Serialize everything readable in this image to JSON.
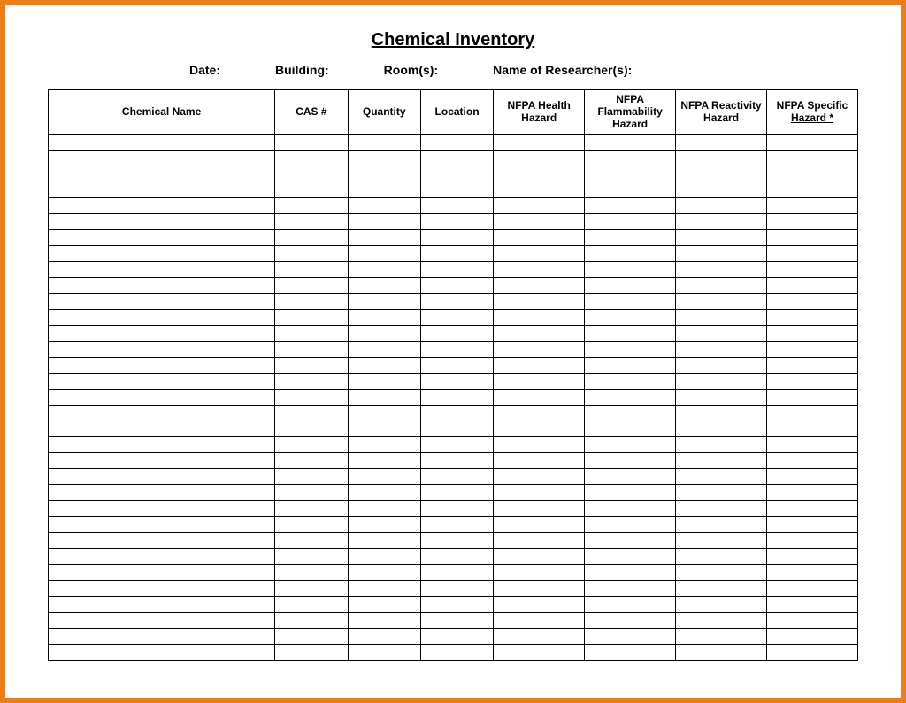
{
  "title": "Chemical Inventory",
  "meta": {
    "date_label": "Date:",
    "building_label": "Building:",
    "rooms_label": "Room(s):",
    "researchers_label": "Name of Researcher(s):"
  },
  "columns": {
    "chemical_name": "Chemical Name",
    "cas": "CAS #",
    "quantity": "Quantity",
    "location": "Location",
    "nfpa_health": "NFPA Health Hazard",
    "nfpa_flammability": "NFPA Flammability Hazard",
    "nfpa_reactivity": "NFPA Reactivity Hazard",
    "nfpa_specific": "NFPA Specific",
    "hazard_star": "Hazard *"
  },
  "row_count": 33
}
